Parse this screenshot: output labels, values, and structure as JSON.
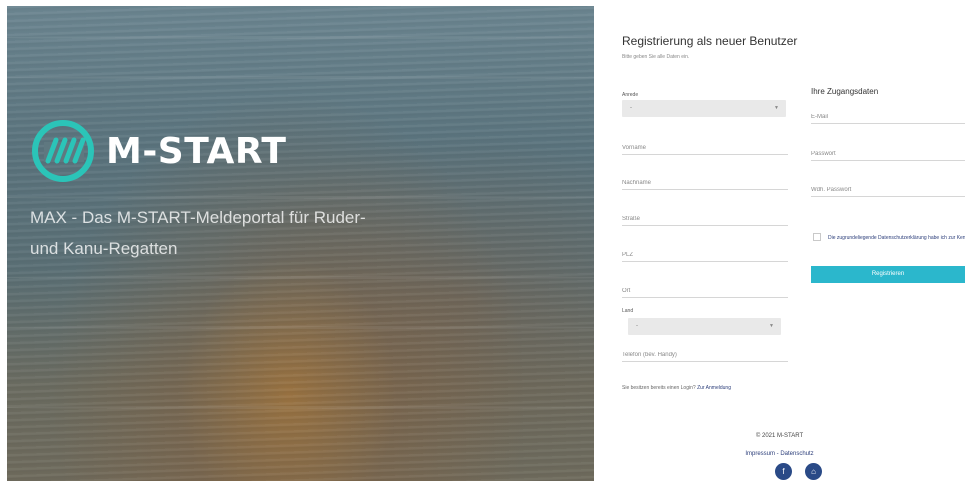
{
  "hero": {
    "brand": "M-START",
    "tagline": "MAX - Das M-START-Meldeportal für Ruder- und Kanu-Regatten"
  },
  "form": {
    "title": "Registrierung als neuer Benutzer",
    "subtitle": "Bitte geben Sie alle Daten ein.",
    "anrede": {
      "label": "Anrede",
      "value": "-"
    },
    "vorname": {
      "placeholder": "Vorname"
    },
    "nachname": {
      "placeholder": "Nachname"
    },
    "strasse": {
      "placeholder": "Straße"
    },
    "plz": {
      "placeholder": "PLZ"
    },
    "ort": {
      "placeholder": "Ort"
    },
    "land": {
      "label": "Land",
      "value": "-"
    },
    "telefon": {
      "placeholder": "Telefon (bev. Handy)"
    },
    "access": {
      "title": "Ihre Zugangsdaten",
      "email": {
        "placeholder": "E-Mail"
      },
      "password": {
        "placeholder": "Passwort"
      },
      "password_repeat": {
        "placeholder": "Wdh. Passwort"
      }
    },
    "privacy_text": "Die zugrundeliegende Datenschutzerklärung habe ich zur Kenntnis genommen.",
    "register_button": "Registrieren",
    "login_prompt": "Sie besitzen bereits einen Login?",
    "login_link": "Zur Anmeldung"
  },
  "footer": {
    "copyright": "© 2021 M-START",
    "impressum": "Impressum",
    "separator": " - ",
    "datenschutz": "Datenschutz",
    "facebook_glyph": "f",
    "home_glyph": "⌂"
  },
  "colors": {
    "accent": "#2bb7cc",
    "link": "#2c3e7a",
    "logo": "#2bc4b8"
  }
}
